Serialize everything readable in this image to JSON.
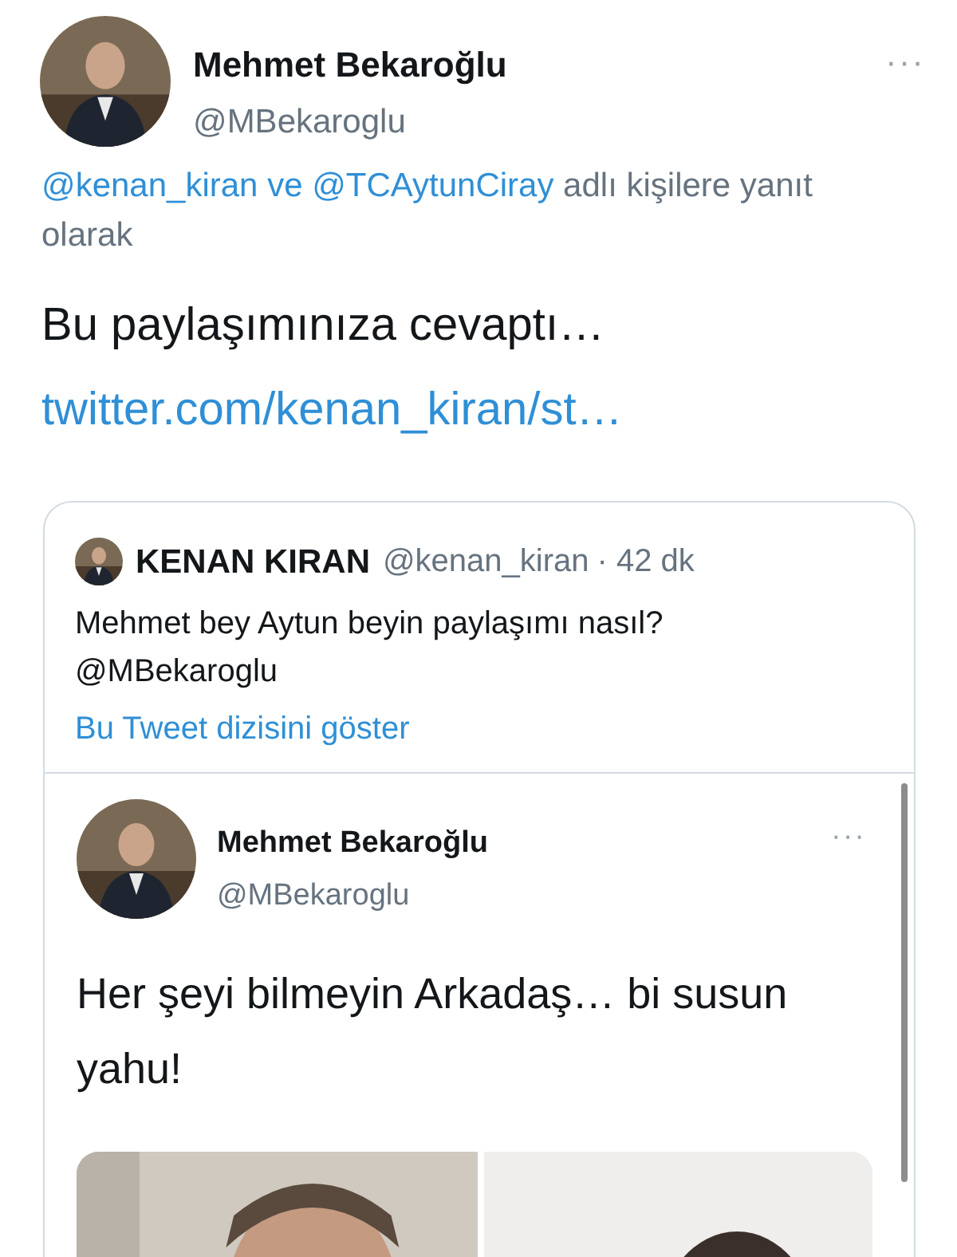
{
  "tweet": {
    "name": "Mehmet Bekaroğlu",
    "handle": "@MBekaroglu",
    "menu": "···",
    "reply_to": {
      "mentions": "@kenan_kiran ve @TCAytunCiray",
      "suffix": "adlı kişilere yanıt olarak"
    },
    "text": "Bu paylaşımınıza cevaptı…",
    "link": "twitter.com/kenan_kiran/st…"
  },
  "quote": {
    "name": "KENAN KIRAN",
    "handle": "@kenan_kiran",
    "time": "· 42 dk",
    "text": "Mehmet bey Aytun beyin paylaşımı nasıl? @MBekaroglu",
    "thread_link": "Bu Tweet dizisini göster",
    "embedded": {
      "name": "Mehmet Bekaroğlu",
      "handle": "@MBekaroglu",
      "menu": "···",
      "text": "Her şeyi bilmeyin Arkadaş… bi susun yahu!"
    }
  }
}
